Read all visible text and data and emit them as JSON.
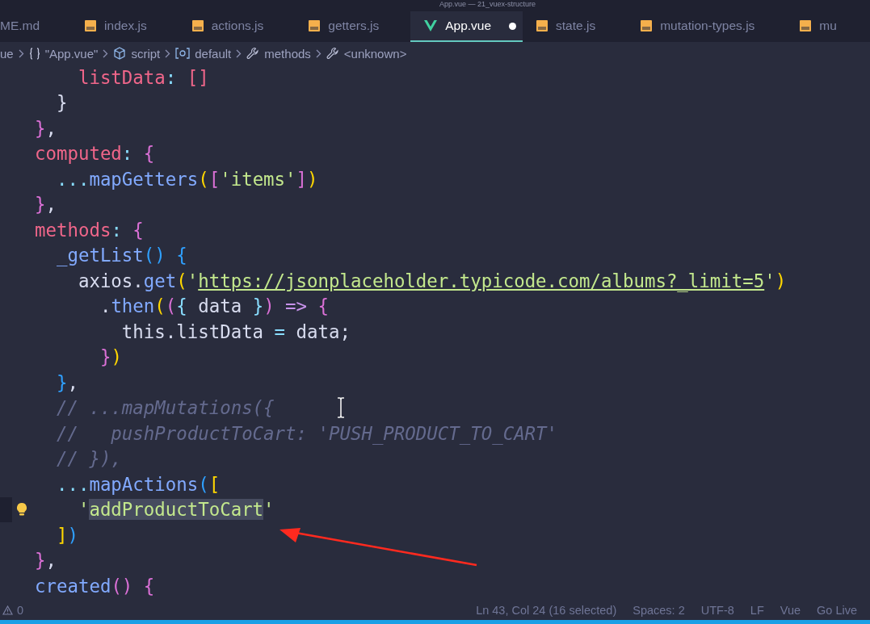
{
  "window": {
    "title": "App.vue — 21_vuex-structure"
  },
  "tabs": [
    {
      "label": "ME.md",
      "kind": "plain",
      "selected": false,
      "modified": false
    },
    {
      "label": "index.js",
      "kind": "js",
      "selected": false,
      "modified": false
    },
    {
      "label": "actions.js",
      "kind": "js",
      "selected": false,
      "modified": false
    },
    {
      "label": "getters.js",
      "kind": "js",
      "selected": false,
      "modified": false
    },
    {
      "label": "App.vue",
      "kind": "vue",
      "selected": true,
      "modified": true
    },
    {
      "label": "state.js",
      "kind": "js",
      "selected": false,
      "modified": false
    },
    {
      "label": "mutation-types.js",
      "kind": "js",
      "selected": false,
      "modified": false
    },
    {
      "label": "mu",
      "kind": "js",
      "selected": false,
      "modified": false
    }
  ],
  "breadcrumb": [
    {
      "label": "ue",
      "kind": "folder"
    },
    {
      "label": "\"App.vue\"",
      "kind": "module"
    },
    {
      "label": "script",
      "kind": "section"
    },
    {
      "label": "default",
      "kind": "field"
    },
    {
      "label": "methods",
      "kind": "method"
    },
    {
      "label": "<unknown>",
      "kind": "method"
    }
  ],
  "code_lines": [
    {
      "lightbulb": false,
      "tokens": [
        {
          "kind": "key",
          "text": "    listData"
        },
        {
          "kind": "punct",
          "text": ": "
        },
        {
          "kind": "key",
          "text": "[]"
        }
      ]
    },
    {
      "lightbulb": false,
      "tokens": [
        {
          "kind": "plain",
          "text": "  }"
        }
      ]
    },
    {
      "lightbulb": false,
      "tokens": [
        {
          "kind": "b2",
          "text": "}"
        },
        {
          "kind": "plain",
          "text": ","
        }
      ]
    },
    {
      "lightbulb": false,
      "tokens": [
        {
          "kind": "key",
          "text": "computed"
        },
        {
          "kind": "punct",
          "text": ": "
        },
        {
          "kind": "b2",
          "text": "{"
        }
      ]
    },
    {
      "lightbulb": false,
      "tokens": [
        {
          "kind": "punct",
          "text": "  ..."
        },
        {
          "kind": "func",
          "text": "mapGetters"
        },
        {
          "kind": "b1",
          "text": "("
        },
        {
          "kind": "b2",
          "text": "["
        },
        {
          "kind": "string",
          "text": "'items'"
        },
        {
          "kind": "b2",
          "text": "]"
        },
        {
          "kind": "b1",
          "text": ")"
        }
      ]
    },
    {
      "lightbulb": false,
      "tokens": [
        {
          "kind": "b2",
          "text": "}"
        },
        {
          "kind": "plain",
          "text": ","
        }
      ]
    },
    {
      "lightbulb": false,
      "tokens": [
        {
          "kind": "key",
          "text": "methods"
        },
        {
          "kind": "punct",
          "text": ": "
        },
        {
          "kind": "b2",
          "text": "{"
        }
      ]
    },
    {
      "lightbulb": false,
      "tokens": [
        {
          "kind": "func",
          "text": "  _getList"
        },
        {
          "kind": "b3",
          "text": "()"
        },
        {
          "kind": "b3",
          "text": " {"
        }
      ]
    },
    {
      "lightbulb": false,
      "tokens": [
        {
          "kind": "plain",
          "text": "    axios."
        },
        {
          "kind": "func",
          "text": "get"
        },
        {
          "kind": "b1",
          "text": "("
        },
        {
          "kind": "string",
          "text": "'"
        },
        {
          "kind": "link",
          "text": "https://jsonplaceholder.typicode.com/albums?_limit=5"
        },
        {
          "kind": "string",
          "text": "'"
        },
        {
          "kind": "b1",
          "text": ")"
        }
      ]
    },
    {
      "lightbulb": false,
      "tokens": [
        {
          "kind": "plain",
          "text": "      ."
        },
        {
          "kind": "func",
          "text": "then"
        },
        {
          "kind": "b1",
          "text": "("
        },
        {
          "kind": "b2",
          "text": "("
        },
        {
          "kind": "punct",
          "text": "{"
        },
        {
          "kind": "plain",
          "text": " data "
        },
        {
          "kind": "punct",
          "text": "}"
        },
        {
          "kind": "b2",
          "text": ")"
        },
        {
          "kind": "keyword",
          "text": " => "
        },
        {
          "kind": "b2",
          "text": "{"
        }
      ]
    },
    {
      "lightbulb": false,
      "tokens": [
        {
          "kind": "plain",
          "text": "        this.listData "
        },
        {
          "kind": "punct",
          "text": "="
        },
        {
          "kind": "plain",
          "text": " data;"
        }
      ]
    },
    {
      "lightbulb": false,
      "tokens": [
        {
          "kind": "b2",
          "text": "      }"
        },
        {
          "kind": "b1",
          "text": ")"
        }
      ]
    },
    {
      "lightbulb": false,
      "tokens": [
        {
          "kind": "b3",
          "text": "  }"
        },
        {
          "kind": "plain",
          "text": ","
        }
      ]
    },
    {
      "lightbulb": false,
      "tokens": [
        {
          "kind": "comment",
          "text": "  // ...mapMutations({"
        }
      ]
    },
    {
      "lightbulb": false,
      "tokens": [
        {
          "kind": "comment",
          "text": "  //   pushProductToCart: 'PUSH_PRODUCT_TO_CART'"
        }
      ]
    },
    {
      "lightbulb": false,
      "tokens": [
        {
          "kind": "comment",
          "text": "  // }),"
        }
      ]
    },
    {
      "lightbulb": false,
      "tokens": [
        {
          "kind": "punct",
          "text": "  ..."
        },
        {
          "kind": "func",
          "text": "mapActions"
        },
        {
          "kind": "b3",
          "text": "("
        },
        {
          "kind": "b1",
          "text": "["
        }
      ]
    },
    {
      "lightbulb": true,
      "tokens": [
        {
          "kind": "string",
          "text": "    '"
        },
        {
          "kind": "selected",
          "text": "addProductToCart"
        },
        {
          "kind": "string",
          "text": "'"
        }
      ]
    },
    {
      "lightbulb": false,
      "tokens": [
        {
          "kind": "b1",
          "text": "  ]"
        },
        {
          "kind": "b3",
          "text": ")"
        }
      ]
    },
    {
      "lightbulb": false,
      "tokens": [
        {
          "kind": "b2",
          "text": "}"
        },
        {
          "kind": "plain",
          "text": ","
        }
      ]
    },
    {
      "lightbulb": false,
      "tokens": [
        {
          "kind": "func",
          "text": "created"
        },
        {
          "kind": "b2",
          "text": "()"
        },
        {
          "kind": "b2",
          "text": " {"
        }
      ]
    }
  ],
  "annotation": {
    "kind": "arrow"
  },
  "status_bar": {
    "problems": "0",
    "items": [
      "Ln 43, Col 24 (16 selected)",
      "Spaces: 2",
      "UTF-8",
      "LF",
      "Vue",
      "Go Live"
    ]
  }
}
